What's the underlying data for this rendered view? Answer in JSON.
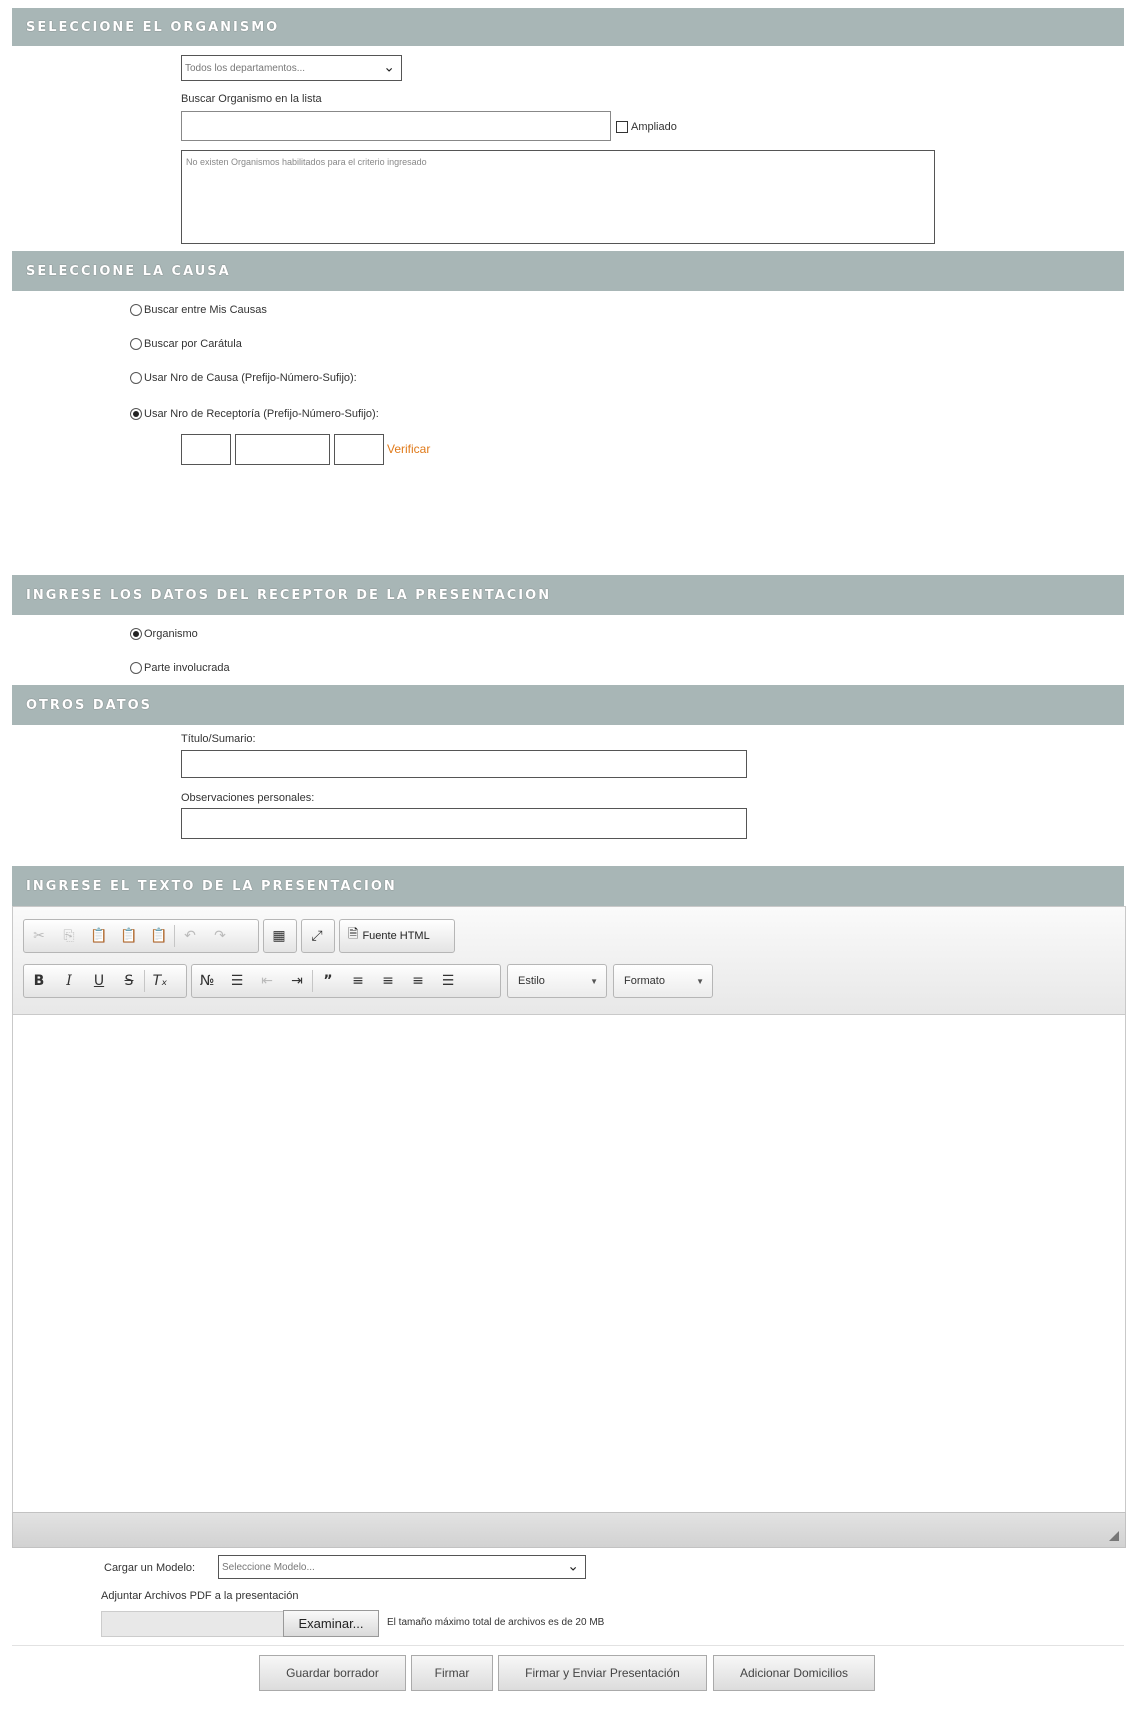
{
  "sections": {
    "organismo": "SELECCIONE EL ORGANISMO",
    "causa": "SELECCIONE LA CAUSA",
    "receptor": "INGRESE LOS DATOS DEL RECEPTOR DE LA PRESENTACION",
    "otros": "OTROS DATOS",
    "texto": "INGRESE EL TEXTO DE LA PRESENTACION"
  },
  "organismo": {
    "department_select": "Todos los departamentos...",
    "search_label": "Buscar Organismo en la lista",
    "search_value": "",
    "ampliado_label": "Ampliado",
    "ampliado_checked": false,
    "list_empty_text": "No existen Organismos habilitados para el criterio ingresado"
  },
  "causa": {
    "options": [
      {
        "label": "Buscar entre Mis Causas",
        "checked": false
      },
      {
        "label": "Buscar por Carátula",
        "checked": false
      },
      {
        "label": "Usar Nro de Causa (Prefijo-Número-Sufijo):",
        "checked": false
      },
      {
        "label": "Usar Nro de Receptoría (Prefijo-Número-Sufijo):",
        "checked": true
      }
    ],
    "verify_label": "Verificar"
  },
  "receptor": {
    "options": [
      {
        "label": "Organismo",
        "checked": true
      },
      {
        "label": "Parte involucrada",
        "checked": false
      }
    ]
  },
  "otros": {
    "titulo_label": "Título/Sumario:",
    "titulo_value": "",
    "observaciones_label": "Observaciones personales:",
    "observaciones_value": ""
  },
  "editor": {
    "row1_icons": [
      "cut-icon",
      "copy-icon",
      "paste-icon",
      "paste-text-icon",
      "paste-word-icon",
      "undo-icon",
      "redo-icon",
      "table-icon",
      "maximize-icon",
      "source-icon"
    ],
    "source_label": "Fuente HTML",
    "row2_icons": [
      "bold-icon",
      "italic-icon",
      "underline-icon",
      "strike-icon",
      "remove-format-icon",
      "numbered-list-icon",
      "bulleted-list-icon",
      "outdent-icon",
      "indent-icon",
      "blockquote-icon",
      "align-left-icon",
      "align-center-icon",
      "align-right-icon",
      "justify-icon"
    ],
    "estilo_label": "Estilo",
    "formato_label": "Formato",
    "content": ""
  },
  "footer": {
    "modelo_label": "Cargar un Modelo:",
    "modelo_select": "Seleccione Modelo...",
    "adjuntar_label": "Adjuntar Archivos PDF a la presentación",
    "examinar_label": "Examinar...",
    "max_size_text": "El tamaño máximo total de archivos es de 20 MB",
    "buttons": {
      "guardar": "Guardar borrador",
      "firmar": "Firmar",
      "firmar_enviar": "Firmar y Enviar Presentación",
      "domicilios": "Adicionar Domicilios"
    }
  }
}
